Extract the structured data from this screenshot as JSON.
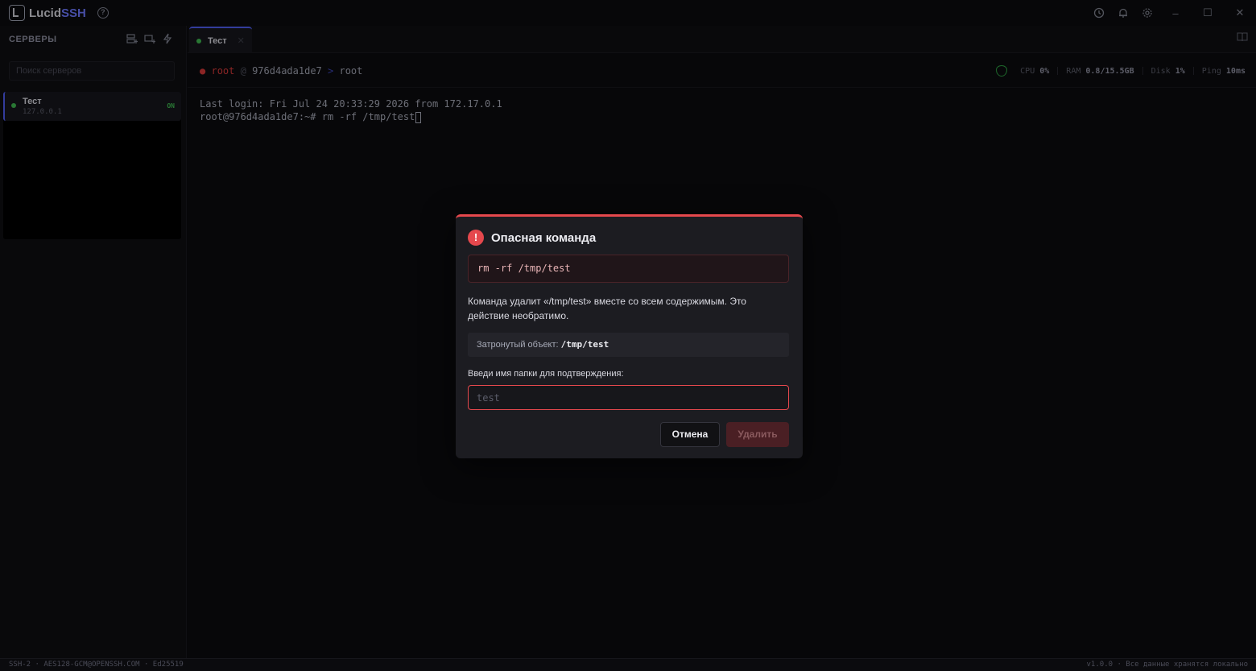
{
  "app": {
    "name_main": "Lucid",
    "name_accent": "SSH",
    "help_icon": "?"
  },
  "titlebar": {
    "icons": [
      "history-icon",
      "bell-icon",
      "gear-icon"
    ],
    "window_controls": {
      "minimize": "–",
      "maximize": "☐",
      "close": "✕"
    }
  },
  "sidebar": {
    "title": "СЕРВЕРЫ",
    "search_placeholder": "Поиск серверов",
    "servers": [
      {
        "name": "Тест",
        "ip": "127.0.0.1",
        "status": "ON"
      }
    ]
  },
  "tabs": [
    {
      "label": "Тест",
      "close": "✕"
    }
  ],
  "terminal_header": {
    "dot": "●",
    "user": "root",
    "at": "@",
    "host": "976d4ada1de7",
    "arrow": ">",
    "path": "root",
    "stats": [
      {
        "label": "CPU",
        "value": "0%"
      },
      {
        "label": "RAM",
        "value": "0.8/15.5GB"
      },
      {
        "label": "Disk",
        "value": "1%"
      },
      {
        "label": "Ping",
        "value": "10ms"
      }
    ]
  },
  "terminal": {
    "line1": "Last login: Fri Jul 24 20:33:29 2026 from 172.17.0.1",
    "line2": "root@976d4ada1de7:~# rm -rf /tmp/test"
  },
  "dialog": {
    "icon": "!",
    "title": "Опасная команда",
    "command": "rm -rf /tmp/test",
    "description": "Команда удалит «/tmp/test» вместе со всем содержимым. Это действие необратимо.",
    "affected_label": "Затронутый объект: ",
    "affected_path": "/tmp/test",
    "confirm_label": "Введи имя папки для подтверждения:",
    "input_placeholder": "test",
    "cancel_label": "Отмена",
    "delete_label": "Удалить"
  },
  "statusbar": {
    "left": "SSH-2 · AES128-GCM@OPENSSH.COM · Ed25519",
    "right": "v1.0.0 · Все данные хранятся локально"
  },
  "colors": {
    "accent": "#4f5cf0",
    "danger": "#e5484d",
    "online": "#3fb950"
  }
}
